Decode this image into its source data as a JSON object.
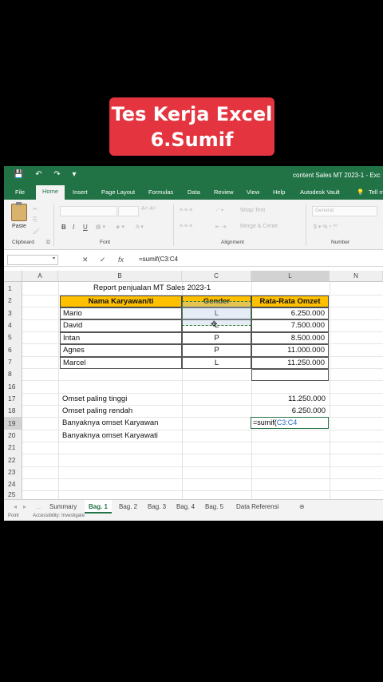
{
  "caption": {
    "line1": "Tes Kerja Excel",
    "line2": "6.Sumif"
  },
  "titlebar": {
    "document": "content Sales MT 2023-1  -  Exc"
  },
  "tabs": [
    "File",
    "Home",
    "Insert",
    "Page Layout",
    "Formulas",
    "Data",
    "Review",
    "View",
    "Help",
    "Autodesk Vault",
    "Tell m"
  ],
  "active_tab": "Home",
  "ribbon": {
    "paste": "Paste",
    "groups": {
      "clipboard": "Clipboard",
      "font": "Font",
      "alignment": "Alignment",
      "number": "Number"
    },
    "font_buttons": [
      "B",
      "I",
      "U"
    ],
    "wrap_text": "Wrap Text",
    "merge": "Merge & Cente",
    "number_format": "General"
  },
  "formula_bar": {
    "name_box": "",
    "cancel": "✕",
    "enter": "✓",
    "fx": "fx",
    "formula": "=sumif(C3:C4"
  },
  "columns": [
    "A",
    "B",
    "C",
    "L",
    "N"
  ],
  "rows": [
    "1",
    "2",
    "3",
    "4",
    "5",
    "6",
    "7",
    "8",
    "16",
    "17",
    "18",
    "19",
    "20",
    "21",
    "22",
    "23",
    "24",
    "25"
  ],
  "sheet": {
    "title": "Report penjualan MT Sales 2023-1",
    "headers": {
      "name": "Nama Karyawan/ti",
      "gender": "Gender",
      "omzet": "Rata-Rata Omzet"
    },
    "records": [
      {
        "name": "Mario",
        "gender": "L",
        "omzet": "6.250.000"
      },
      {
        "name": "David",
        "gender": "L",
        "omzet": "7.500.000"
      },
      {
        "name": "Intan",
        "gender": "P",
        "omzet": "8.500.000"
      },
      {
        "name": "Agnes",
        "gender": "P",
        "omzet": "11.000.000"
      },
      {
        "name": "Marcel",
        "gender": "L",
        "omzet": "11.250.000"
      }
    ],
    "summary": {
      "highest_label": "Omset paling tinggi",
      "highest_value": "11.250.000",
      "lowest_label": "Omset paling rendah",
      "lowest_value": "6.250.000",
      "male_label": "Banyaknya omset Karyawan",
      "male_formula_prefix": "=sumif(",
      "male_formula_ref": "C3:C4",
      "female_label": "Banyaknya omset Karyawati"
    }
  },
  "sheet_tabs": [
    "Summary",
    "Bag. 1",
    "Bag. 2",
    "Bag. 3",
    "Bag. 4",
    "Bag. 5",
    "Data Referensi"
  ],
  "active_sheet": "Bag. 1",
  "status": {
    "mode": "Point",
    "accessibility": "Accessibility: Investigate"
  }
}
